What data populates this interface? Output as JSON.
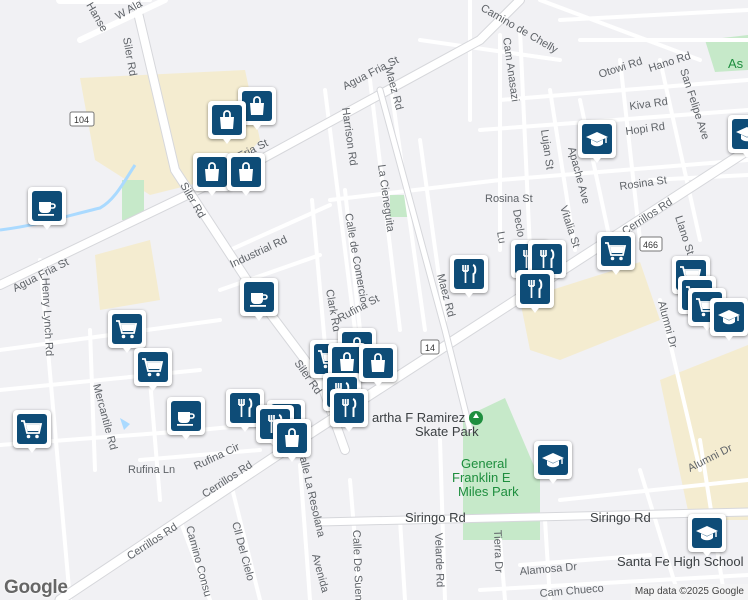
{
  "map": {
    "attribution": "Map data ©2025 Google",
    "logo": "Google",
    "colors": {
      "background": "#f1f1f4",
      "road": "#ffffff",
      "road_edge": "#d6d7db",
      "major_road": "#ffffff",
      "park": "#c6e9c9",
      "area": "#f4ecd0",
      "water": "#aadaff",
      "marker": "#0e4c77"
    }
  },
  "streets": [
    {
      "id": "agua-fria-top",
      "text": "Agua Fria St"
    },
    {
      "id": "agua-fria-mid",
      "text": "Fria St"
    },
    {
      "id": "agua-fria-left",
      "text": "Agua Fria St"
    },
    {
      "id": "siler-top",
      "text": "Siler Rd"
    },
    {
      "id": "siler-mid",
      "text": "Siler Rd"
    },
    {
      "id": "siler-low",
      "text": "Siler Rd"
    },
    {
      "id": "maez-top",
      "text": "Maez Rd"
    },
    {
      "id": "maez-mid",
      "text": "Maez Rd"
    },
    {
      "id": "harrison",
      "text": "Harrison Rd"
    },
    {
      "id": "cienega",
      "text": "La Cieneguita"
    },
    {
      "id": "comercio",
      "text": "Calle de Comercio"
    },
    {
      "id": "clark",
      "text": "Clark Rd"
    },
    {
      "id": "rufina",
      "text": "Rufina St"
    },
    {
      "id": "industrial",
      "text": "Industrial Rd"
    },
    {
      "id": "henry-lynch",
      "text": "Henry Lynch Rd"
    },
    {
      "id": "mercantile",
      "text": "Mercantile Rd"
    },
    {
      "id": "rufina-ln",
      "text": "Rufina Ln"
    },
    {
      "id": "rufina-cir",
      "text": "Rufina Cir"
    },
    {
      "id": "cerrillos-left",
      "text": "Cerrillos Rd"
    },
    {
      "id": "cerrillos-far",
      "text": "Cerrillos Rd"
    },
    {
      "id": "cerrillos-right",
      "text": "Cerrillos Rd"
    },
    {
      "id": "cll-cielo",
      "text": "Cll Del Cielo"
    },
    {
      "id": "resolana",
      "text": "Calle La Resolana"
    },
    {
      "id": "camino-consu",
      "text": "Camino Consu"
    },
    {
      "id": "avenida",
      "text": "Avenida"
    },
    {
      "id": "de-suenos",
      "text": "Calle De Sueno"
    },
    {
      "id": "velarde",
      "text": "Velarde Rd"
    },
    {
      "id": "tierra",
      "text": "Tierra Dr"
    },
    {
      "id": "alamosa",
      "text": "Alamosa Dr"
    },
    {
      "id": "cam-chueco",
      "text": "Cam Chueco"
    },
    {
      "id": "siringo-l",
      "text": "Siringo Rd"
    },
    {
      "id": "siringo-r",
      "text": "Siringo Rd"
    },
    {
      "id": "rosina",
      "text": "Rosina St"
    },
    {
      "id": "rosina-r",
      "text": "Rosina St"
    },
    {
      "id": "lujan",
      "text": "Lujan St"
    },
    {
      "id": "apache",
      "text": "Apache Ave"
    },
    {
      "id": "vitalia",
      "text": "Vitalia St"
    },
    {
      "id": "llano",
      "text": "Llano St"
    },
    {
      "id": "alumni",
      "text": "Alumni Dr"
    },
    {
      "id": "alumni-2",
      "text": "Alumni Dr"
    },
    {
      "id": "hopi",
      "text": "Hopi Rd"
    },
    {
      "id": "kiva",
      "text": "Kiva Rd"
    },
    {
      "id": "otowi",
      "text": "Otowi Rd"
    },
    {
      "id": "hano",
      "text": "Hano Rd"
    },
    {
      "id": "san-felipe",
      "text": "San Felipe Ave"
    },
    {
      "id": "cam-anasazi",
      "text": "Cam Anasazi"
    },
    {
      "id": "camino-chelly",
      "text": "Camino de Chelly"
    },
    {
      "id": "w-alameda",
      "text": "W Ala"
    },
    {
      "id": "hansen",
      "text": "Hanse"
    },
    {
      "id": "declo",
      "text": "Declo"
    },
    {
      "id": "lu-short",
      "text": "Lu"
    }
  ],
  "places": [
    {
      "id": "skate-park",
      "text": "Martha F Ramirez Skate Park",
      "line1": "artha F Ramirez",
      "line2": "Skate Park"
    },
    {
      "id": "miles-park",
      "line1": "General",
      "line2": "Franklin E",
      "line3": "Miles Park"
    },
    {
      "id": "high-school",
      "text": "Santa Fe High School"
    },
    {
      "id": "as-edge",
      "text": "As"
    }
  ],
  "shields": [
    {
      "id": "route-104",
      "text": "104"
    },
    {
      "id": "route-14",
      "text": "14"
    },
    {
      "id": "route-466",
      "text": "466"
    }
  ],
  "markers": [
    {
      "id": "m1",
      "icon": "shopping-bag-icon"
    },
    {
      "id": "m2",
      "icon": "shopping-bag-icon"
    },
    {
      "id": "m3",
      "icon": "shopping-bag-icon"
    },
    {
      "id": "m4",
      "icon": "shopping-bag-icon"
    },
    {
      "id": "m5",
      "icon": "coffee-cup-icon"
    },
    {
      "id": "m6",
      "icon": "coffee-cup-icon"
    },
    {
      "id": "m7",
      "icon": "shopping-cart-icon"
    },
    {
      "id": "m8",
      "icon": "shopping-cart-icon"
    },
    {
      "id": "m9",
      "icon": "shopping-cart-icon"
    },
    {
      "id": "m10",
      "icon": "coffee-cup-icon"
    },
    {
      "id": "m11",
      "icon": "restaurant-icon"
    },
    {
      "id": "m12",
      "icon": "shopping-bag-icon"
    },
    {
      "id": "m13",
      "icon": "restaurant-icon"
    },
    {
      "id": "m14",
      "icon": "shopping-bag-icon"
    },
    {
      "id": "m15",
      "icon": "shopping-cart-icon"
    },
    {
      "id": "m16",
      "icon": "shopping-bag-icon"
    },
    {
      "id": "m17",
      "icon": "shopping-bag-icon"
    },
    {
      "id": "m18",
      "icon": "restaurant-icon"
    },
    {
      "id": "m19",
      "icon": "restaurant-icon"
    },
    {
      "id": "m20",
      "icon": "restaurant-icon"
    },
    {
      "id": "m21",
      "icon": "shopping-bag-icon"
    },
    {
      "id": "m22",
      "icon": "restaurant-icon"
    },
    {
      "id": "m23",
      "icon": "restaurant-icon"
    },
    {
      "id": "m24",
      "icon": "restaurant-icon"
    },
    {
      "id": "m25",
      "icon": "graduation-cap-icon"
    },
    {
      "id": "m26",
      "icon": "shopping-cart-icon"
    },
    {
      "id": "m27",
      "icon": "shopping-cart-icon"
    },
    {
      "id": "m28",
      "icon": "shopping-cart-icon"
    },
    {
      "id": "m29",
      "icon": "shopping-cart-icon"
    },
    {
      "id": "m30",
      "icon": "graduation-cap-icon"
    },
    {
      "id": "m31",
      "icon": "graduation-cap-icon"
    },
    {
      "id": "m32",
      "icon": "graduation-cap-icon"
    },
    {
      "id": "m33",
      "icon": "graduation-cap-icon"
    }
  ]
}
